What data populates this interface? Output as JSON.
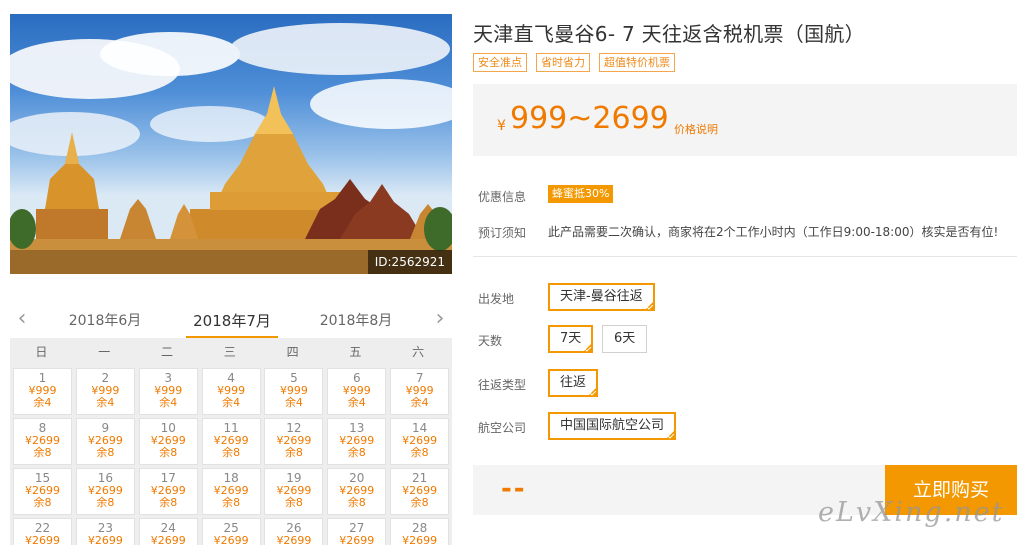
{
  "product": {
    "title": "天津直飞曼谷6- 7 天往返含税机票（国航）",
    "tags": [
      "安全准点",
      "省时省力",
      "超值特价机票"
    ],
    "photo_id": "ID:2562921",
    "price_symbol": "¥",
    "price_range": "999~2699",
    "price_note": "价格说明"
  },
  "info": {
    "discount_label": "优惠信息",
    "discount_badge": "蜂蜜抵30%",
    "notice_label": "预订须知",
    "notice_text": "此产品需要二次确认，商家将在2个工作小时内（工作日9:00-18:00）核实是否有位!"
  },
  "options": {
    "departure_label": "出发地",
    "departure_value": "天津-曼谷往返",
    "days_label": "天数",
    "days_options": [
      "7天",
      "6天"
    ],
    "days_selected": "7天",
    "trip_type_label": "往返类型",
    "trip_type_value": "往返",
    "airline_label": "航空公司",
    "airline_value": "中国国际航空公司"
  },
  "buy": {
    "total_display": "--",
    "button_label": "立即购买"
  },
  "calendar": {
    "prev_icon": "chevron-left-icon",
    "next_icon": "chevron-right-icon",
    "months": [
      "2018年6月",
      "2018年7月",
      "2018年8月"
    ],
    "active_month": "2018年7月",
    "weekdays": [
      "日",
      "一",
      "二",
      "三",
      "四",
      "五",
      "六"
    ],
    "days": [
      {
        "date": "1",
        "price": "¥999",
        "stock": "余4"
      },
      {
        "date": "2",
        "price": "¥999",
        "stock": "余4"
      },
      {
        "date": "3",
        "price": "¥999",
        "stock": "余4"
      },
      {
        "date": "4",
        "price": "¥999",
        "stock": "余4"
      },
      {
        "date": "5",
        "price": "¥999",
        "stock": "余4"
      },
      {
        "date": "6",
        "price": "¥999",
        "stock": "余4"
      },
      {
        "date": "7",
        "price": "¥999",
        "stock": "余4"
      },
      {
        "date": "8",
        "price": "¥2699",
        "stock": "余8"
      },
      {
        "date": "9",
        "price": "¥2699",
        "stock": "余8"
      },
      {
        "date": "10",
        "price": "¥2699",
        "stock": "余8"
      },
      {
        "date": "11",
        "price": "¥2699",
        "stock": "余8"
      },
      {
        "date": "12",
        "price": "¥2699",
        "stock": "余8"
      },
      {
        "date": "13",
        "price": "¥2699",
        "stock": "余8"
      },
      {
        "date": "14",
        "price": "¥2699",
        "stock": "余8"
      },
      {
        "date": "15",
        "price": "¥2699",
        "stock": "余8"
      },
      {
        "date": "16",
        "price": "¥2699",
        "stock": "余8"
      },
      {
        "date": "17",
        "price": "¥2699",
        "stock": "余8"
      },
      {
        "date": "18",
        "price": "¥2699",
        "stock": "余8"
      },
      {
        "date": "19",
        "price": "¥2699",
        "stock": "余8"
      },
      {
        "date": "20",
        "price": "¥2699",
        "stock": "余8"
      },
      {
        "date": "21",
        "price": "¥2699",
        "stock": "余8"
      },
      {
        "date": "22",
        "price": "¥2699",
        "stock": ""
      },
      {
        "date": "23",
        "price": "¥2699",
        "stock": ""
      },
      {
        "date": "24",
        "price": "¥2699",
        "stock": ""
      },
      {
        "date": "25",
        "price": "¥2699",
        "stock": ""
      },
      {
        "date": "26",
        "price": "¥2699",
        "stock": ""
      },
      {
        "date": "27",
        "price": "¥2699",
        "stock": ""
      },
      {
        "date": "28",
        "price": "¥2699",
        "stock": ""
      }
    ]
  },
  "watermark": "eLvXing.net",
  "colors": {
    "accent": "#f39800",
    "price": "#f07a00",
    "tag_border": "#f3a64b",
    "panel_bg": "#f4f4f4"
  }
}
